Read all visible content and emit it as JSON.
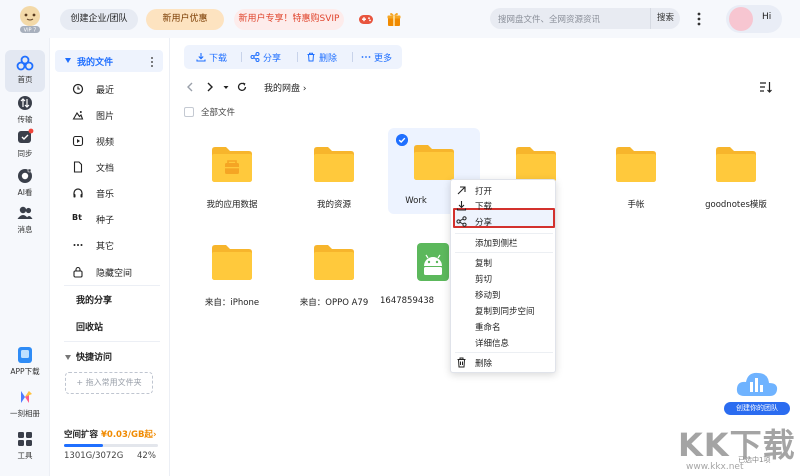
{
  "topbar": {
    "vip_badge": "VIP 7",
    "create_team": "创建企业/团队",
    "new_user_deal": "新用户优惠",
    "svip_promo": "新用户专享！特惠购SVIP",
    "search_placeholder": "搜网盘文件、全网资源资讯",
    "search_button": "搜索",
    "greeting": "Hi"
  },
  "rail": {
    "items": [
      {
        "label": "首页",
        "icon": "cloud-home-icon"
      },
      {
        "label": "传输",
        "icon": "transfer-icon"
      },
      {
        "label": "同步",
        "icon": "sync-icon"
      },
      {
        "label": "AI看",
        "icon": "ai-icon"
      },
      {
        "label": "消息",
        "icon": "message-icon"
      },
      {
        "label": "APP下载",
        "icon": "app-download-icon"
      },
      {
        "label": "一刻相册",
        "icon": "album-icon"
      },
      {
        "label": "工具",
        "icon": "tools-icon"
      }
    ]
  },
  "nav": {
    "my_files": "我的文件",
    "items": [
      {
        "label": "最近",
        "icon": "clock-icon"
      },
      {
        "label": "图片",
        "icon": "image-icon"
      },
      {
        "label": "视频",
        "icon": "video-icon"
      },
      {
        "label": "文档",
        "icon": "document-icon"
      },
      {
        "label": "音乐",
        "icon": "music-icon"
      },
      {
        "label": "种子",
        "icon": "bt-icon",
        "glyph": "Bt"
      },
      {
        "label": "其它",
        "icon": "more-dots-icon"
      },
      {
        "label": "隐藏空间",
        "icon": "lock-icon"
      }
    ],
    "my_share": "我的分享",
    "recycle_bin": "回收站",
    "quick_access": "快捷访问",
    "drag_hint": "+ 拖入常用文件夹",
    "storage_title": "空间扩容",
    "storage_offer": "¥0.03/GB起",
    "storage_used": "1301G/3072G",
    "storage_percent": "42%",
    "storage_fraction": 0.42
  },
  "toolbar": {
    "download": "下载",
    "share": "分享",
    "delete": "删除",
    "more": "更多"
  },
  "path": {
    "crumb": "我的网盘"
  },
  "select_all": "全部文件",
  "files": [
    {
      "name": "我的应用数据",
      "type": "folder-app",
      "selected": false
    },
    {
      "name": "我的资源",
      "type": "folder",
      "selected": false
    },
    {
      "name": "Work",
      "type": "folder",
      "selected": true
    },
    {
      "name": "",
      "type": "folder",
      "selected": false
    },
    {
      "name": "手帐",
      "type": "folder",
      "selected": false
    },
    {
      "name": "goodnotes模版",
      "type": "folder",
      "selected": false
    },
    {
      "name": "来自：iPhone",
      "type": "folder",
      "selected": false
    },
    {
      "name": "来自：OPPO A79",
      "type": "folder",
      "selected": false
    },
    {
      "name": "1647859438",
      "type": "apk",
      "selected": false
    }
  ],
  "context_menu": {
    "items": [
      {
        "label": "打开",
        "icon": "open-arrow-icon"
      },
      {
        "label": "下载",
        "icon": "download-icon"
      },
      {
        "label": "分享",
        "icon": "share-icon",
        "highlighted": true
      },
      {
        "label": "添加到侧栏",
        "icon": ""
      },
      {
        "label": "复制",
        "icon": ""
      },
      {
        "label": "剪切",
        "icon": ""
      },
      {
        "label": "移动到",
        "icon": ""
      },
      {
        "label": "复制到同步空间",
        "icon": ""
      },
      {
        "label": "重命名",
        "icon": ""
      },
      {
        "label": "详细信息",
        "icon": ""
      },
      {
        "label": "删除",
        "icon": "trash-icon"
      }
    ]
  },
  "promo": {
    "create_team": "创建你的团队",
    "tip": "已选中1项"
  },
  "watermark": {
    "main": "KK下载",
    "sub": "www.kkx.net"
  },
  "colors": {
    "accent": "#1f6fff",
    "folder": "#ffc93c",
    "highlight_border": "#d3312d",
    "selected_bg": "#edf3ff"
  }
}
